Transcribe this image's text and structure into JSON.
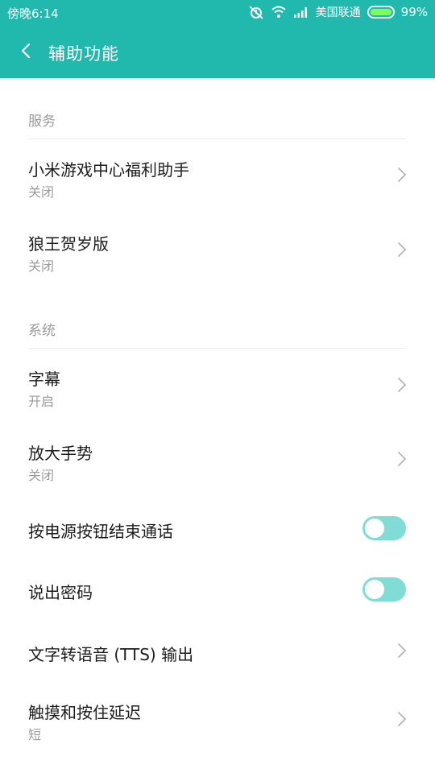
{
  "status_bar": {
    "time": "傍晚6:14",
    "carrier": "美国联通",
    "battery": "99%",
    "icons": [
      "alarm-icon",
      "wifi-icon",
      "signal-icon",
      "battery-icon"
    ]
  },
  "header": {
    "title": "辅助功能",
    "back_icon": "back-arrow-icon"
  },
  "sections": {
    "services": {
      "label": "服务",
      "items": [
        {
          "title": "小米游戏中心福利助手",
          "subtitle": "关闭"
        },
        {
          "title": "狼王贺岁版",
          "subtitle": "关闭"
        }
      ]
    },
    "system": {
      "label": "系统",
      "items": [
        {
          "title": "字幕",
          "subtitle": "开启"
        },
        {
          "title": "放大手势",
          "subtitle": "关闭"
        },
        {
          "title": "按电源按钮结束通话",
          "toggle": false
        },
        {
          "title": "说出密码",
          "toggle": false
        },
        {
          "title": "文字转语音 (TTS) 输出"
        },
        {
          "title": "触摸和按住延迟",
          "subtitle": "短"
        }
      ]
    }
  },
  "colors": {
    "accent": "#21b9ad",
    "toggle_track": "#82dcd6",
    "section_text": "#9a9a9a",
    "title_text": "#1c1c1c",
    "subtitle_text": "#9b9b9b"
  }
}
